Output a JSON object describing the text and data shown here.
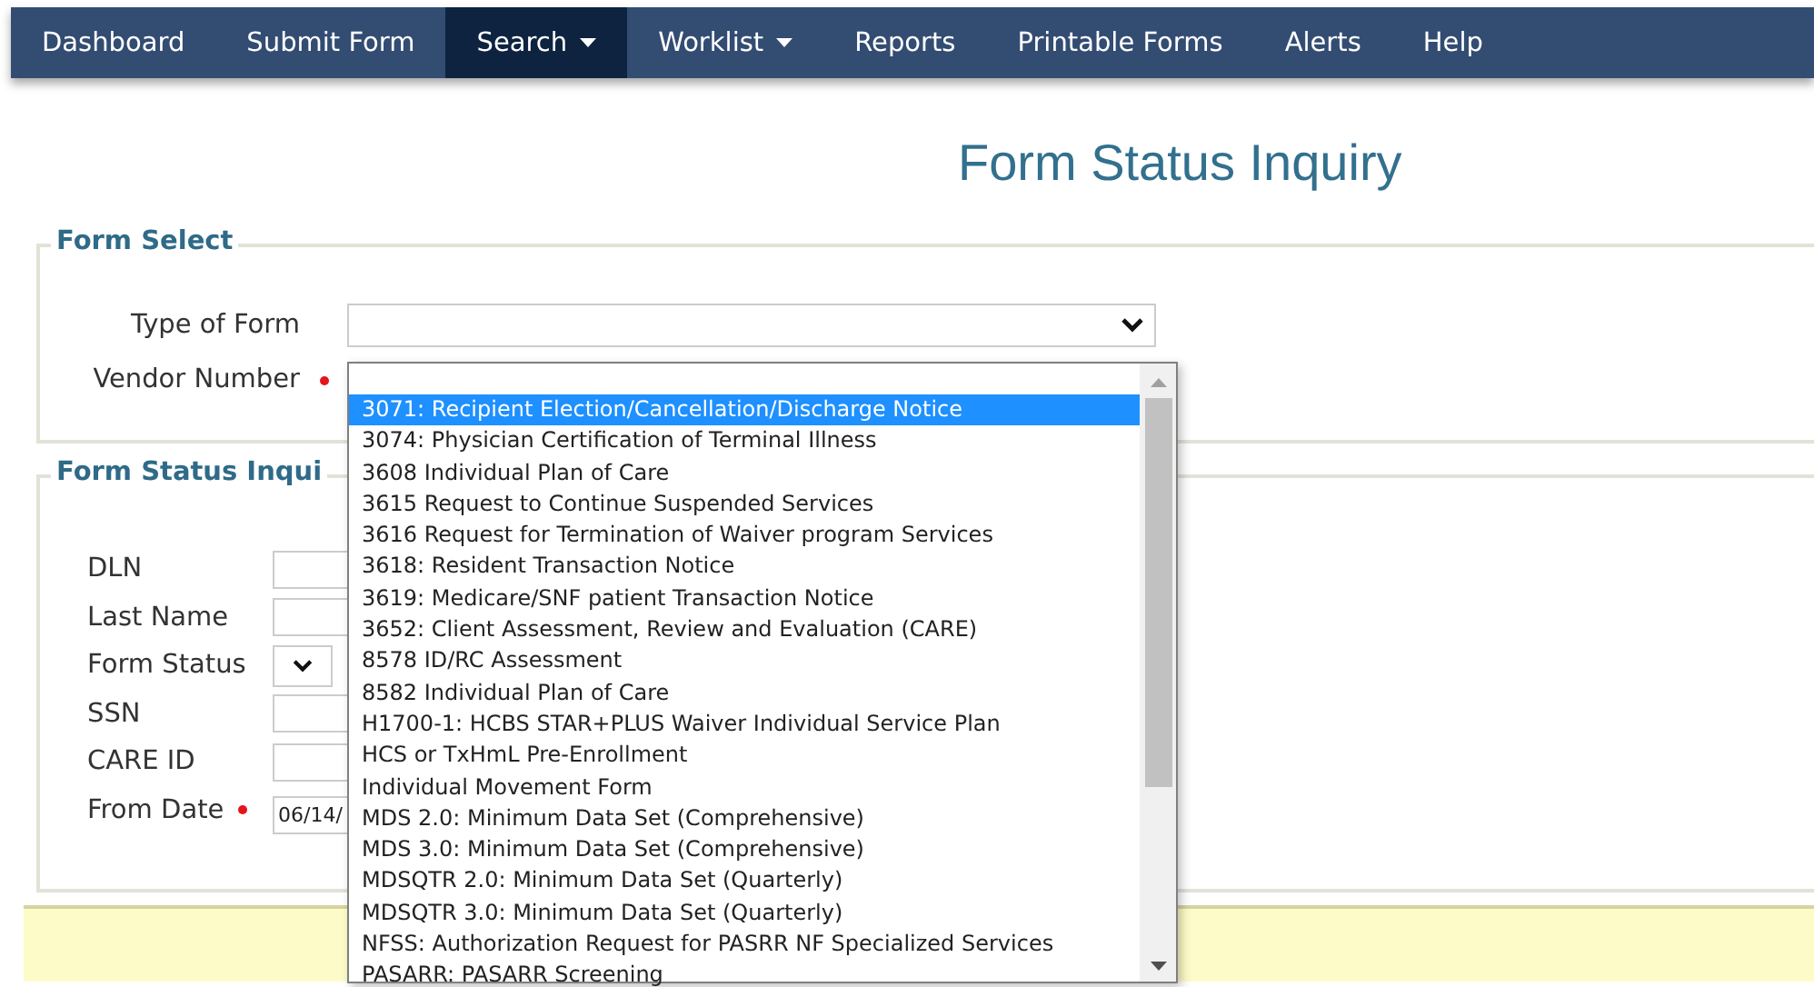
{
  "nav": [
    {
      "label": "Dashboard",
      "selected": false,
      "has_menu": false
    },
    {
      "label": "Submit Form",
      "selected": false,
      "has_menu": false
    },
    {
      "label": "Search",
      "selected": true,
      "has_menu": true
    },
    {
      "label": "Worklist",
      "selected": false,
      "has_menu": true
    },
    {
      "label": "Reports",
      "selected": false,
      "has_menu": false
    },
    {
      "label": "Printable Forms",
      "selected": false,
      "has_menu": false
    },
    {
      "label": "Alerts",
      "selected": false,
      "has_menu": false
    },
    {
      "label": "Help",
      "selected": false,
      "has_menu": false
    }
  ],
  "title": "Form Status Inquiry",
  "form_select": {
    "legend": "Form Select",
    "fields": [
      {
        "label": "Type of Form",
        "required": false
      },
      {
        "label": "Vendor Number",
        "required": true
      }
    ]
  },
  "form_status": {
    "legend": "Form Status Inqui",
    "fields": [
      {
        "label": "DLN",
        "kind": "input",
        "required": false
      },
      {
        "label": "Last Name",
        "kind": "input",
        "required": false
      },
      {
        "label": "Form Status",
        "kind": "select",
        "required": false
      },
      {
        "label": "SSN",
        "kind": "input",
        "required": false
      },
      {
        "label": "CARE ID",
        "kind": "input",
        "required": false
      },
      {
        "label": "From Date",
        "kind": "input",
        "required": true,
        "value": "06/14/"
      }
    ]
  },
  "dropdown": {
    "options": [
      {
        "label": "3071: Recipient Election/Cancellation/Discharge Notice",
        "selected": true
      },
      {
        "label": "3074: Physician Certification of Terminal Illness",
        "selected": false
      },
      {
        "label": "3608 Individual Plan of Care",
        "selected": false
      },
      {
        "label": "3615 Request to Continue Suspended Services",
        "selected": false
      },
      {
        "label": "3616 Request for Termination of Waiver program Services",
        "selected": false
      },
      {
        "label": "3618: Resident Transaction Notice",
        "selected": false
      },
      {
        "label": "3619: Medicare/SNF patient Transaction Notice",
        "selected": false
      },
      {
        "label": "3652: Client Assessment, Review and Evaluation (CARE)",
        "selected": false
      },
      {
        "label": "8578 ID/RC Assessment",
        "selected": false
      },
      {
        "label": "8582 Individual Plan of Care",
        "selected": false
      },
      {
        "label": "H1700-1: HCBS STAR+PLUS Waiver Individual Service Plan",
        "selected": false
      },
      {
        "label": "HCS or TxHmL Pre-Enrollment",
        "selected": false
      },
      {
        "label": "Individual Movement Form",
        "selected": false
      },
      {
        "label": "MDS 2.0: Minimum Data Set (Comprehensive)",
        "selected": false
      },
      {
        "label": "MDS 3.0: Minimum Data Set (Comprehensive)",
        "selected": false
      },
      {
        "label": "MDSQTR 2.0: Minimum Data Set (Quarterly)",
        "selected": false
      },
      {
        "label": "MDSQTR 3.0: Minimum Data Set (Quarterly)",
        "selected": false
      },
      {
        "label": "NFSS: Authorization Request for PASRR NF Specialized Services",
        "selected": false
      },
      {
        "label": "PASARR: PASARR Screening",
        "selected": false
      }
    ]
  }
}
